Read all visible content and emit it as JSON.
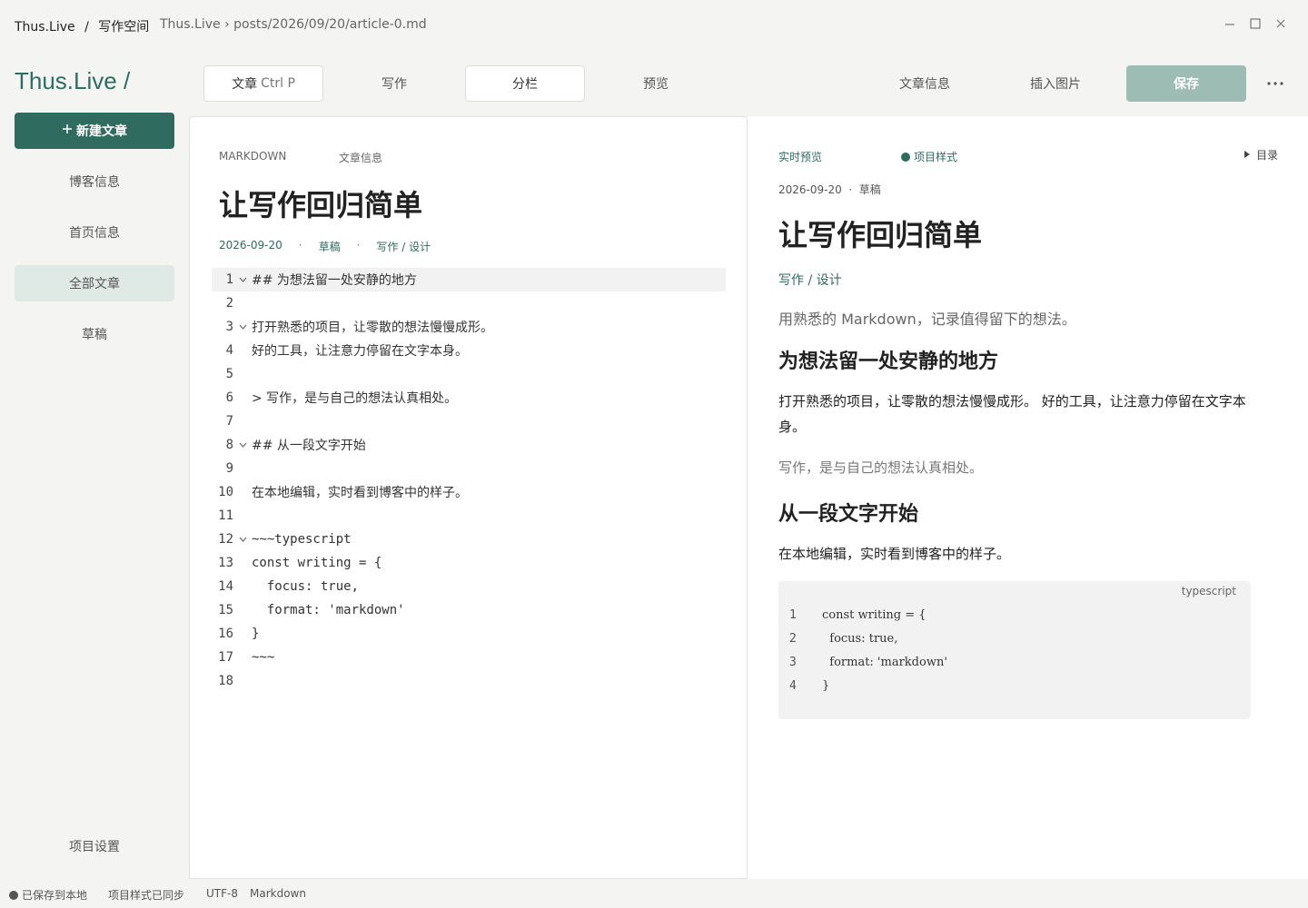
{
  "titlebar": {
    "app": "Thus.Live",
    "sep": "/",
    "workspace": "写作空间",
    "path": "Thus.Live › posts/2026/09/20/article-0.md",
    "minimize_icon": "minimize-icon",
    "maximize_icon": "maximize-icon",
    "close_icon": "close-icon"
  },
  "sidebar": {
    "brand": "Thus.Live /",
    "new_article": "新建文章",
    "items": [
      {
        "label": "博客信息",
        "active": false
      },
      {
        "label": "首页信息",
        "active": false
      },
      {
        "label": "全部文章",
        "active": true
      },
      {
        "label": "草稿",
        "active": false
      }
    ],
    "settings": "项目设置"
  },
  "toolbar": {
    "file_label": "文章",
    "file_shortcut": "Ctrl P",
    "write": "写作",
    "split": "分栏",
    "preview": "预览",
    "article_info": "文章信息",
    "insert_image": "插入图片",
    "save": "保存",
    "more": "···"
  },
  "editor": {
    "tab_markdown": "MARKDOWN",
    "tab_info": "文章信息",
    "title": "让写作回归简单",
    "date": "2026-09-20",
    "dot": "·",
    "status": "草稿",
    "category": "写作 / 设计",
    "lines": [
      {
        "n": "1",
        "fold": true,
        "text": "## 为想法留一处安静的地方",
        "active": true
      },
      {
        "n": "2",
        "fold": false,
        "text": ""
      },
      {
        "n": "3",
        "fold": true,
        "text": "打开熟悉的项目，让零散的想法慢慢成形。"
      },
      {
        "n": "4",
        "fold": false,
        "text": "好的工具，让注意力停留在文字本身。"
      },
      {
        "n": "5",
        "fold": false,
        "text": ""
      },
      {
        "n": "6",
        "fold": false,
        "text": "> 写作，是与自己的想法认真相处。"
      },
      {
        "n": "7",
        "fold": false,
        "text": ""
      },
      {
        "n": "8",
        "fold": true,
        "text": "## 从一段文字开始"
      },
      {
        "n": "9",
        "fold": false,
        "text": ""
      },
      {
        "n": "10",
        "fold": false,
        "text": "在本地编辑，实时看到博客中的样子。"
      },
      {
        "n": "11",
        "fold": false,
        "text": ""
      },
      {
        "n": "12",
        "fold": true,
        "text": "~~~typescript",
        "mono": true
      },
      {
        "n": "13",
        "fold": false,
        "text": "const writing = {",
        "mono": true
      },
      {
        "n": "14",
        "fold": false,
        "text": "  focus: true,",
        "mono": true
      },
      {
        "n": "15",
        "fold": false,
        "text": "  format: 'markdown'",
        "mono": true
      },
      {
        "n": "16",
        "fold": false,
        "text": "}",
        "mono": true
      },
      {
        "n": "17",
        "fold": false,
        "text": "~~~",
        "mono": true
      },
      {
        "n": "18",
        "fold": false,
        "text": ""
      }
    ]
  },
  "preview": {
    "tab_live": "实时预览",
    "tab_style": "项目样式",
    "toc": "目录",
    "meta": "2026-09-20  ·  草稿",
    "title": "让写作回归简单",
    "category": "写作 / 设计",
    "lead": "用熟悉的 Markdown，记录值得留下的想法。",
    "h2_1": "为想法留一处安静的地方",
    "p1": "打开熟悉的项目，让零散的想法慢慢成形。 好的工具，让注意力停留在文字本身。",
    "quote": "写作，是与自己的想法认真相处。",
    "h2_2": "从一段文字开始",
    "p2": "在本地编辑，实时看到博客中的样子。",
    "code_lang": "typescript",
    "code_lines": [
      {
        "n": "1",
        "text": "const writing = {"
      },
      {
        "n": "2",
        "text": "  focus: true,"
      },
      {
        "n": "3",
        "text": "  format: 'markdown'"
      },
      {
        "n": "4",
        "text": "}"
      }
    ]
  },
  "statusbar": {
    "saved": "已保存到本地",
    "synced": "项目样式已同步",
    "encoding": "UTF-8",
    "language": "Markdown"
  },
  "colors": {
    "accent": "#2f6b5e",
    "save_disabled": "#9dbdb4",
    "active_nav": "#dfe9e5"
  }
}
